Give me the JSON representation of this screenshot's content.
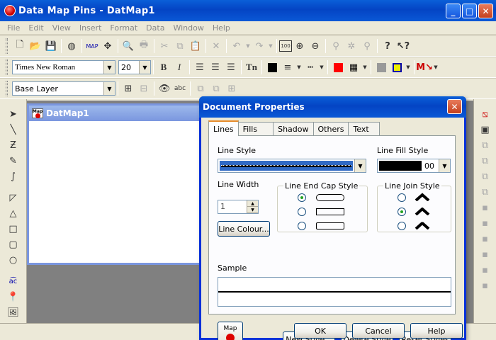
{
  "window": {
    "title": "Data Map Pins - DatMap1"
  },
  "menu": [
    "File",
    "Edit",
    "View",
    "Insert",
    "Format",
    "Data",
    "Window",
    "Help"
  ],
  "toolbar": {
    "font_family": "Times New Roman",
    "font_size": "20",
    "bold_label": "B",
    "italic_label": "I",
    "layer": "Base Layer",
    "text_btn": "abc",
    "zoom_label": "100"
  },
  "document": {
    "title": "DatMap1",
    "icon_text": "Map"
  },
  "dialog": {
    "title": "Document Properties",
    "tabs": [
      "Lines",
      "Fills",
      "Shadow",
      "Others",
      "Text"
    ],
    "active_tab": "Lines",
    "line_style_label": "Line Style",
    "line_fill_style_label": "Line Fill Style",
    "line_fill_value": "00",
    "line_width_label": "Line Width",
    "line_width_value": "1",
    "line_colour_button": "Line Colour...",
    "end_cap_group": "Line End Cap Style",
    "join_group": "Line Join Style",
    "sample_label": "Sample",
    "map_button": "Map",
    "new_style": "New Style...",
    "delete_style": "Delete Style",
    "reset_styles": "Reset Styles",
    "ok": "OK",
    "cancel": "Cancel",
    "help": "Help",
    "end_cap_selected": 0,
    "join_selected": 1
  },
  "colors": {
    "title_blue": "#0a5fd8",
    "accent_red": "#d00000"
  }
}
